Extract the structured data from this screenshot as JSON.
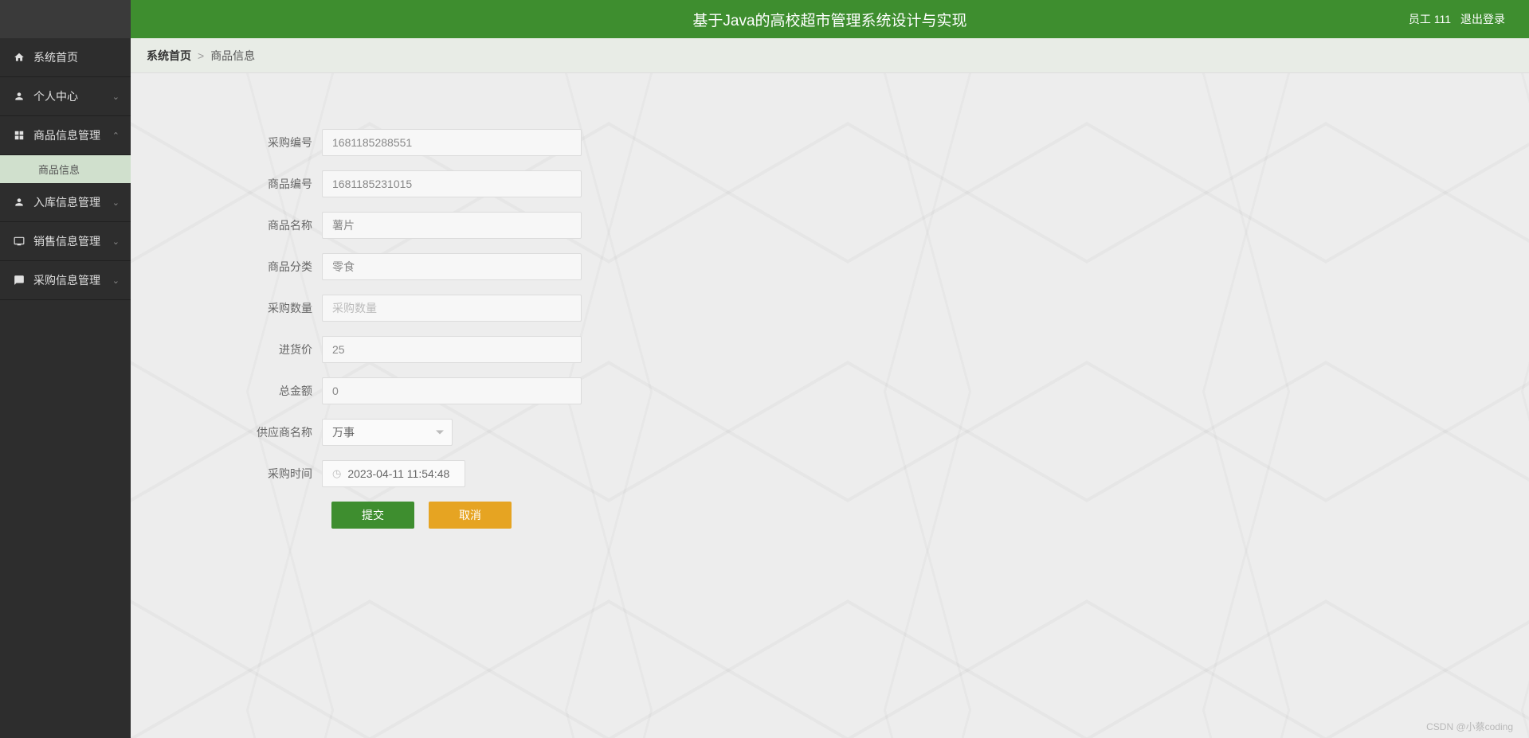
{
  "header": {
    "title": "基于Java的高校超市管理系统设计与实现",
    "user": "员工 111",
    "logout": "退出登录"
  },
  "breadcrumb": {
    "home": "系统首页",
    "sep": ">",
    "current": "商品信息"
  },
  "sidebar": {
    "items": [
      {
        "label": "系统首页"
      },
      {
        "label": "个人中心"
      },
      {
        "label": "商品信息管理"
      },
      {
        "label": "入库信息管理"
      },
      {
        "label": "销售信息管理"
      },
      {
        "label": "采购信息管理"
      }
    ],
    "subitem": "商品信息"
  },
  "form": {
    "purchase_no": {
      "label": "采购编号",
      "value": "1681185288551"
    },
    "product_no": {
      "label": "商品编号",
      "value": "1681185231015"
    },
    "product_name": {
      "label": "商品名称",
      "value": "薯片"
    },
    "category": {
      "label": "商品分类",
      "value": "零食"
    },
    "purchase_qty": {
      "label": "采购数量",
      "placeholder": "采购数量",
      "value": ""
    },
    "purchase_price": {
      "label": "进货价",
      "value": "25"
    },
    "total": {
      "label": "总金额",
      "value": "0"
    },
    "supplier": {
      "label": "供应商名称",
      "value": "万事"
    },
    "purchase_time": {
      "label": "采购时间",
      "value": "2023-04-11 11:54:48"
    },
    "submit": "提交",
    "cancel": "取消"
  },
  "watermark": "CSDN @小蔡coding"
}
